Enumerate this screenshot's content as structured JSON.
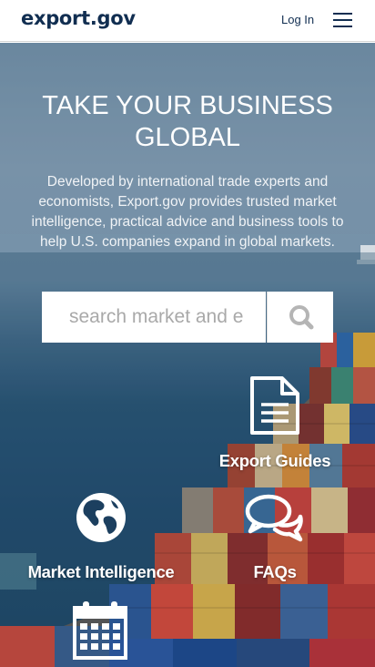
{
  "header": {
    "logo": "export.gov",
    "login_label": "Log In",
    "menu_icon": "hamburger-menu-icon"
  },
  "hero": {
    "title": "TAKE YOUR BUSINESS GLOBAL",
    "description": "Developed by international trade experts and economists, Export.gov provides trusted market intelligence, practical advice and business tools to help U.S. companies expand in global markets."
  },
  "search": {
    "placeholder": "search market and e",
    "button_icon": "search-icon"
  },
  "tiles": [
    {
      "label": "Export Guides",
      "icon": "document-icon"
    },
    {
      "label": "Market Intelligence",
      "icon": "globe-icon"
    },
    {
      "label": "FAQs",
      "icon": "chat-bubbles-icon"
    },
    {
      "label": "",
      "icon": "calendar-icon"
    }
  ],
  "colors": {
    "brand_navy": "#112e51",
    "hero_text": "#ffffff",
    "search_bg": "#ffffff",
    "search_icon": "#b5b5b5"
  }
}
